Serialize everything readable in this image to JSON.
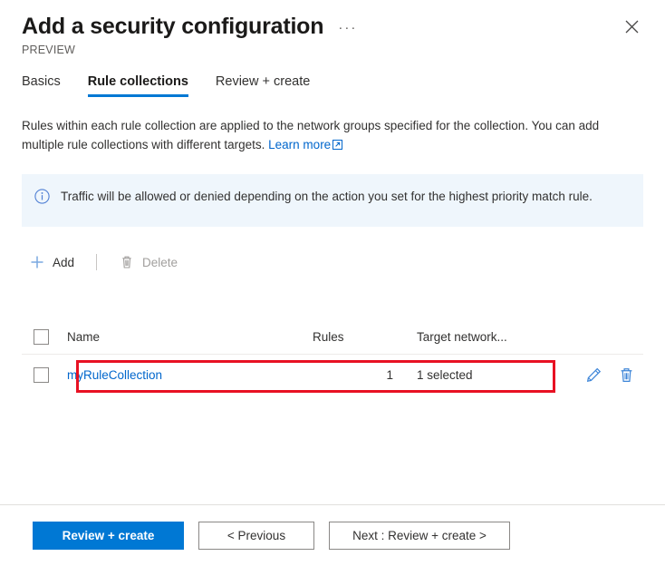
{
  "header": {
    "title": "Add a security configuration",
    "preview_label": "PREVIEW",
    "ellipsis_label": "···",
    "close_label": "Close"
  },
  "tabs": [
    {
      "label": "Basics",
      "active": false
    },
    {
      "label": "Rule collections",
      "active": true
    },
    {
      "label": "Review + create",
      "active": false
    }
  ],
  "description": {
    "line1": "Rules within each rule collection are applied to the network groups specified for the collection.",
    "line2": "You can add multiple rule collections with different targets.",
    "link_text": "Learn more"
  },
  "info_banner": {
    "icon": "info-circle-icon",
    "text": "Traffic will be allowed or denied depending on the action you set for the highest priority match rule."
  },
  "command_bar": {
    "add_label": "Add",
    "delete_label": "Delete"
  },
  "table": {
    "columns": [
      "Name",
      "Rules",
      "Target network..."
    ],
    "rows": [
      {
        "name": "myRuleCollection",
        "rules": "1",
        "target_networks": "1 selected"
      }
    ]
  },
  "footer": {
    "primary_label": "Review + create",
    "previous_label": "< Previous",
    "next_label": "Next : Review + create >"
  },
  "colors": {
    "accent": "#0078d4",
    "link": "#0066cc",
    "highlight": "#e81123",
    "info_bg": "#eff6fc",
    "disabled_text": "#a19f9d"
  }
}
